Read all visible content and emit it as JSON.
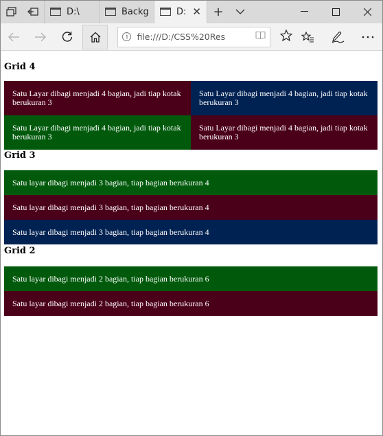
{
  "browser": {
    "tabs": [
      {
        "label": "D:\\",
        "active": false
      },
      {
        "label": "Backgı",
        "active": false
      },
      {
        "label": "D:\\",
        "active": true
      }
    ],
    "address_url": "file:///D:/CSS%20Res"
  },
  "page": {
    "sections": [
      {
        "heading": "Grid 4",
        "cells": [
          "Satu Layar dibagi menjadi 4 bagian, jadi tiap kotak berukuran 3",
          "Satu Layar dibagi menjadi 4 bagian, jadi tiap kotak berukuran 3",
          "Satu Layar dibagi menjadi 4 bagian, jadi tiap kotak berukuran 3",
          "Satu Layar dibagi menjadi 4 bagian, jadi tiap kotak berukuran 3"
        ]
      },
      {
        "heading": "Grid 3",
        "cells": [
          "Satu layar dibagi menjadi 3 bagian, tiap bagian berukuran 4",
          "Satu layar dibagi menjadi 3 bagian, tiap bagian berukuran 4",
          "Satu layar dibagi menjadi 3 bagian, tiap bagian berukuran 4"
        ]
      },
      {
        "heading": "Grid 2",
        "cells": [
          "Satu layar dibagi menjadi 2 bagian, tiap bagian berukuran 6",
          "Satu layar dibagi menjadi 2 bagian, tiap bagian berukuran 6"
        ]
      }
    ]
  },
  "colors": {
    "maroon": "#4b0019",
    "navy": "#002252",
    "green": "#015a0c"
  },
  "icons": {
    "titlebar": [
      "tab-manager-icon",
      "set-aside-tabs-icon"
    ],
    "navigation": [
      "back-arrow-icon",
      "forward-arrow-icon",
      "refresh-icon",
      "home-icon"
    ],
    "address": [
      "info-icon",
      "reading-view-icon",
      "favorite-star-icon"
    ],
    "toolbar": [
      "favorites-hub-icon",
      "pen-notes-icon",
      "more-menu-icon"
    ],
    "window": [
      "minimize-icon",
      "maximize-icon",
      "close-icon"
    ]
  }
}
